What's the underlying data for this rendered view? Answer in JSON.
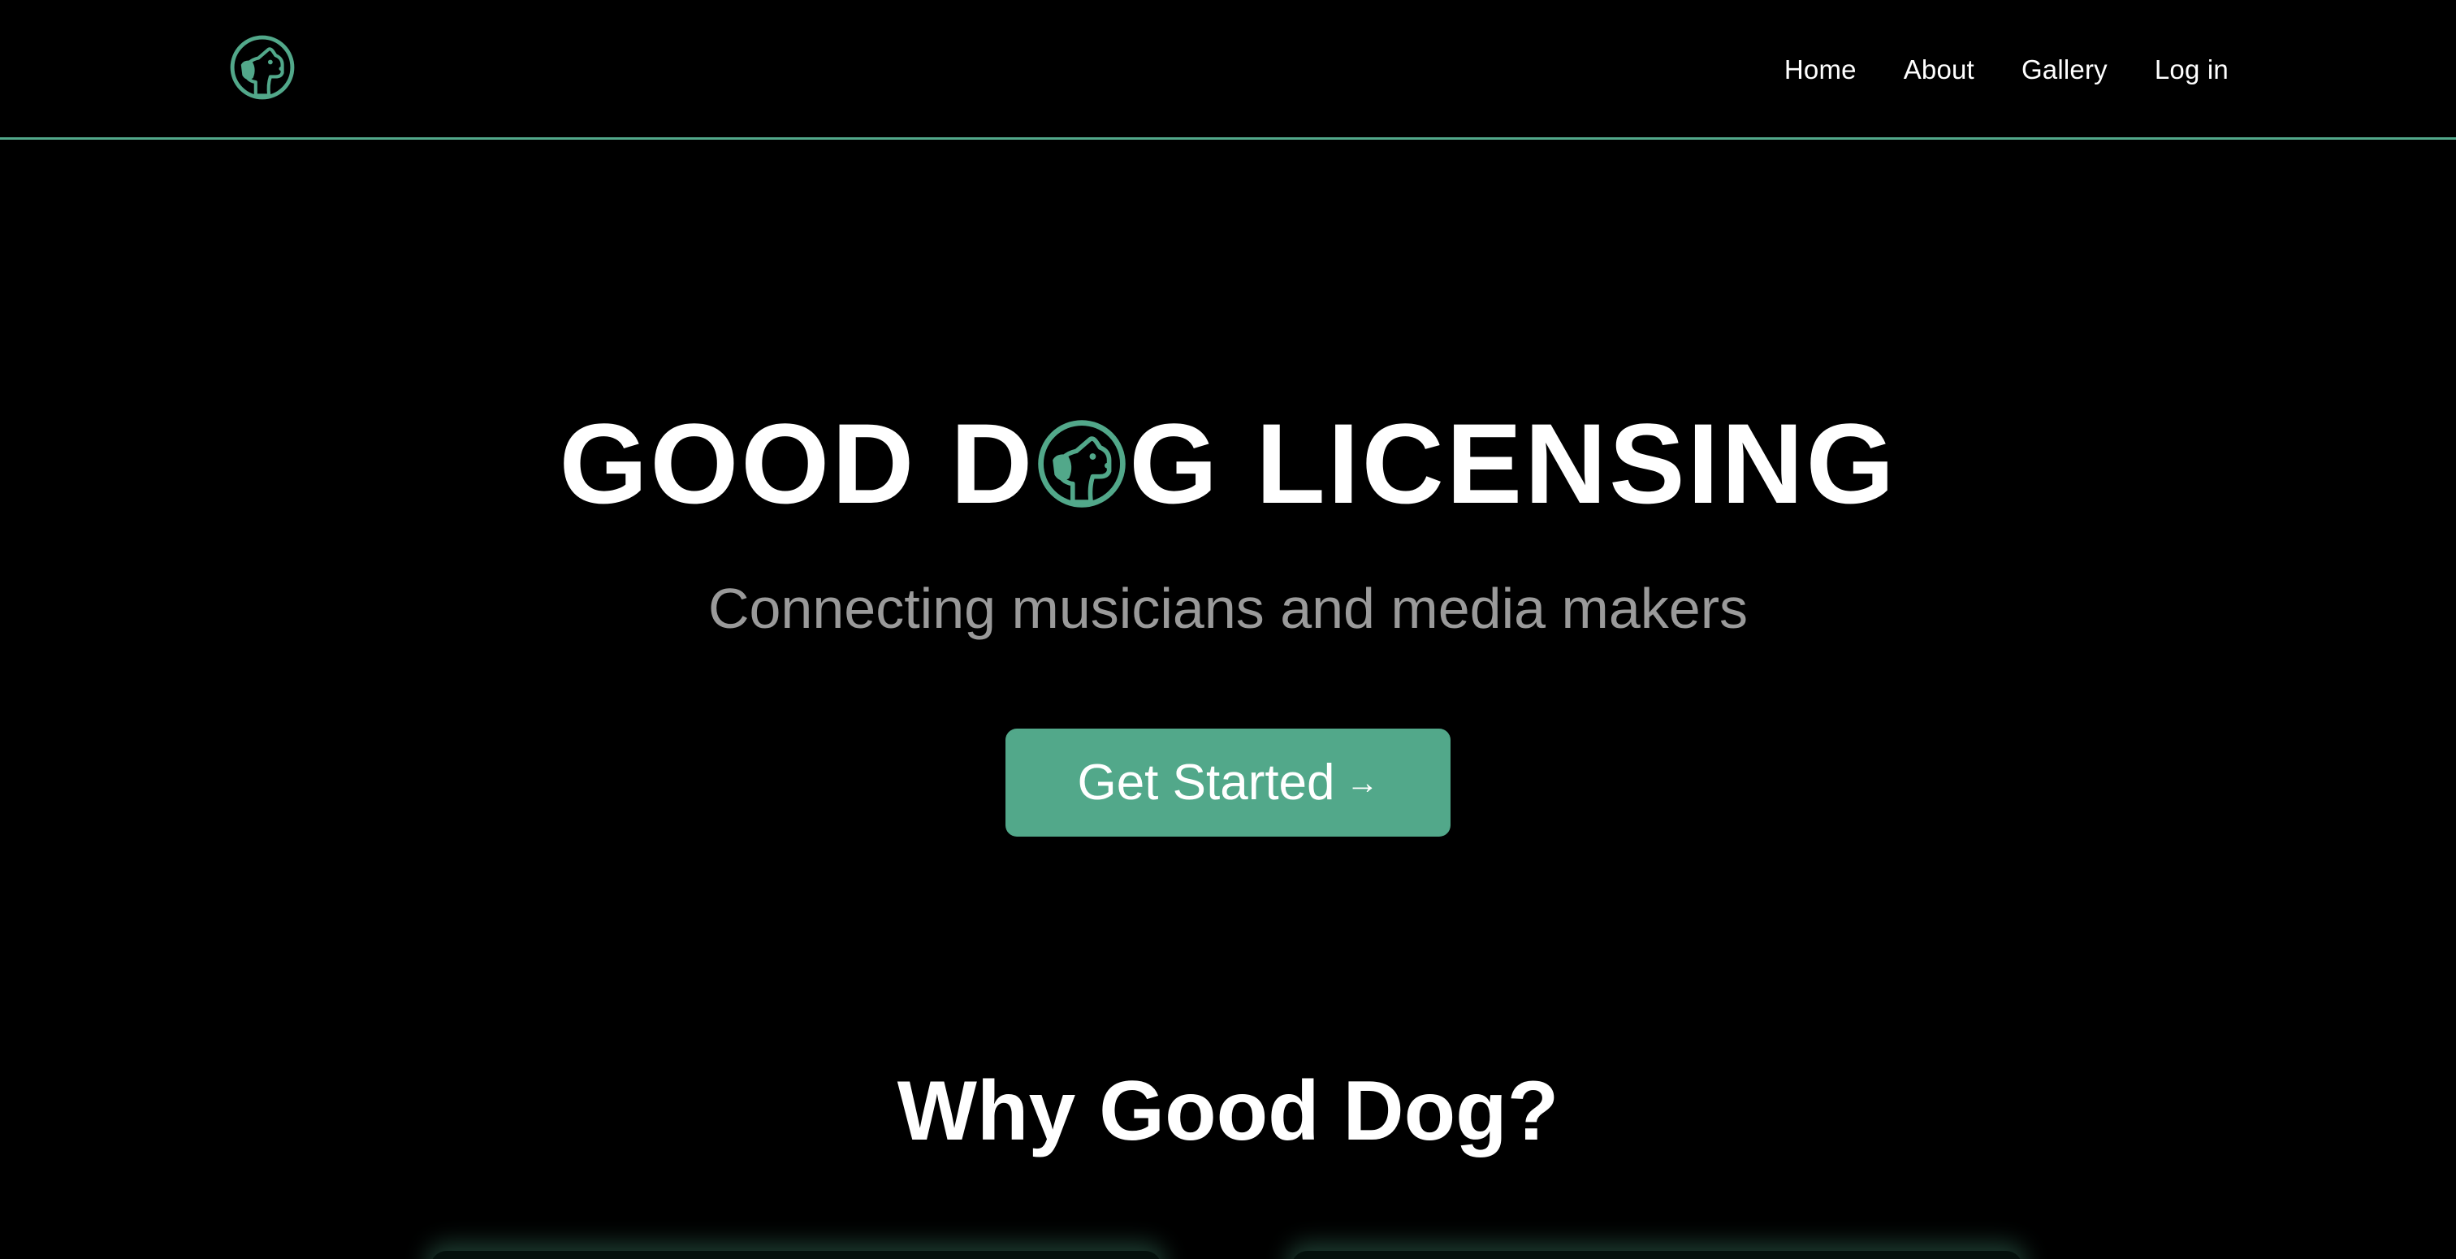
{
  "colors": {
    "background": "#000000",
    "accent": "#52a88a",
    "text": "#ffffff",
    "subtitle": "#9a9a9a"
  },
  "header": {
    "logo_icon": "dog-logo-icon",
    "nav": [
      {
        "label": "Home"
      },
      {
        "label": "About"
      },
      {
        "label": "Gallery"
      },
      {
        "label": "Log in"
      }
    ]
  },
  "hero": {
    "title_part1": "GOOD D",
    "title_logo_icon": "dog-logo-icon",
    "title_part2": "G",
    "title_part3": "LICENSING",
    "subtitle": "Connecting musicians and media makers",
    "cta_label": "Get Started",
    "cta_arrow": "→"
  },
  "section": {
    "title": "Why Good Dog?"
  }
}
